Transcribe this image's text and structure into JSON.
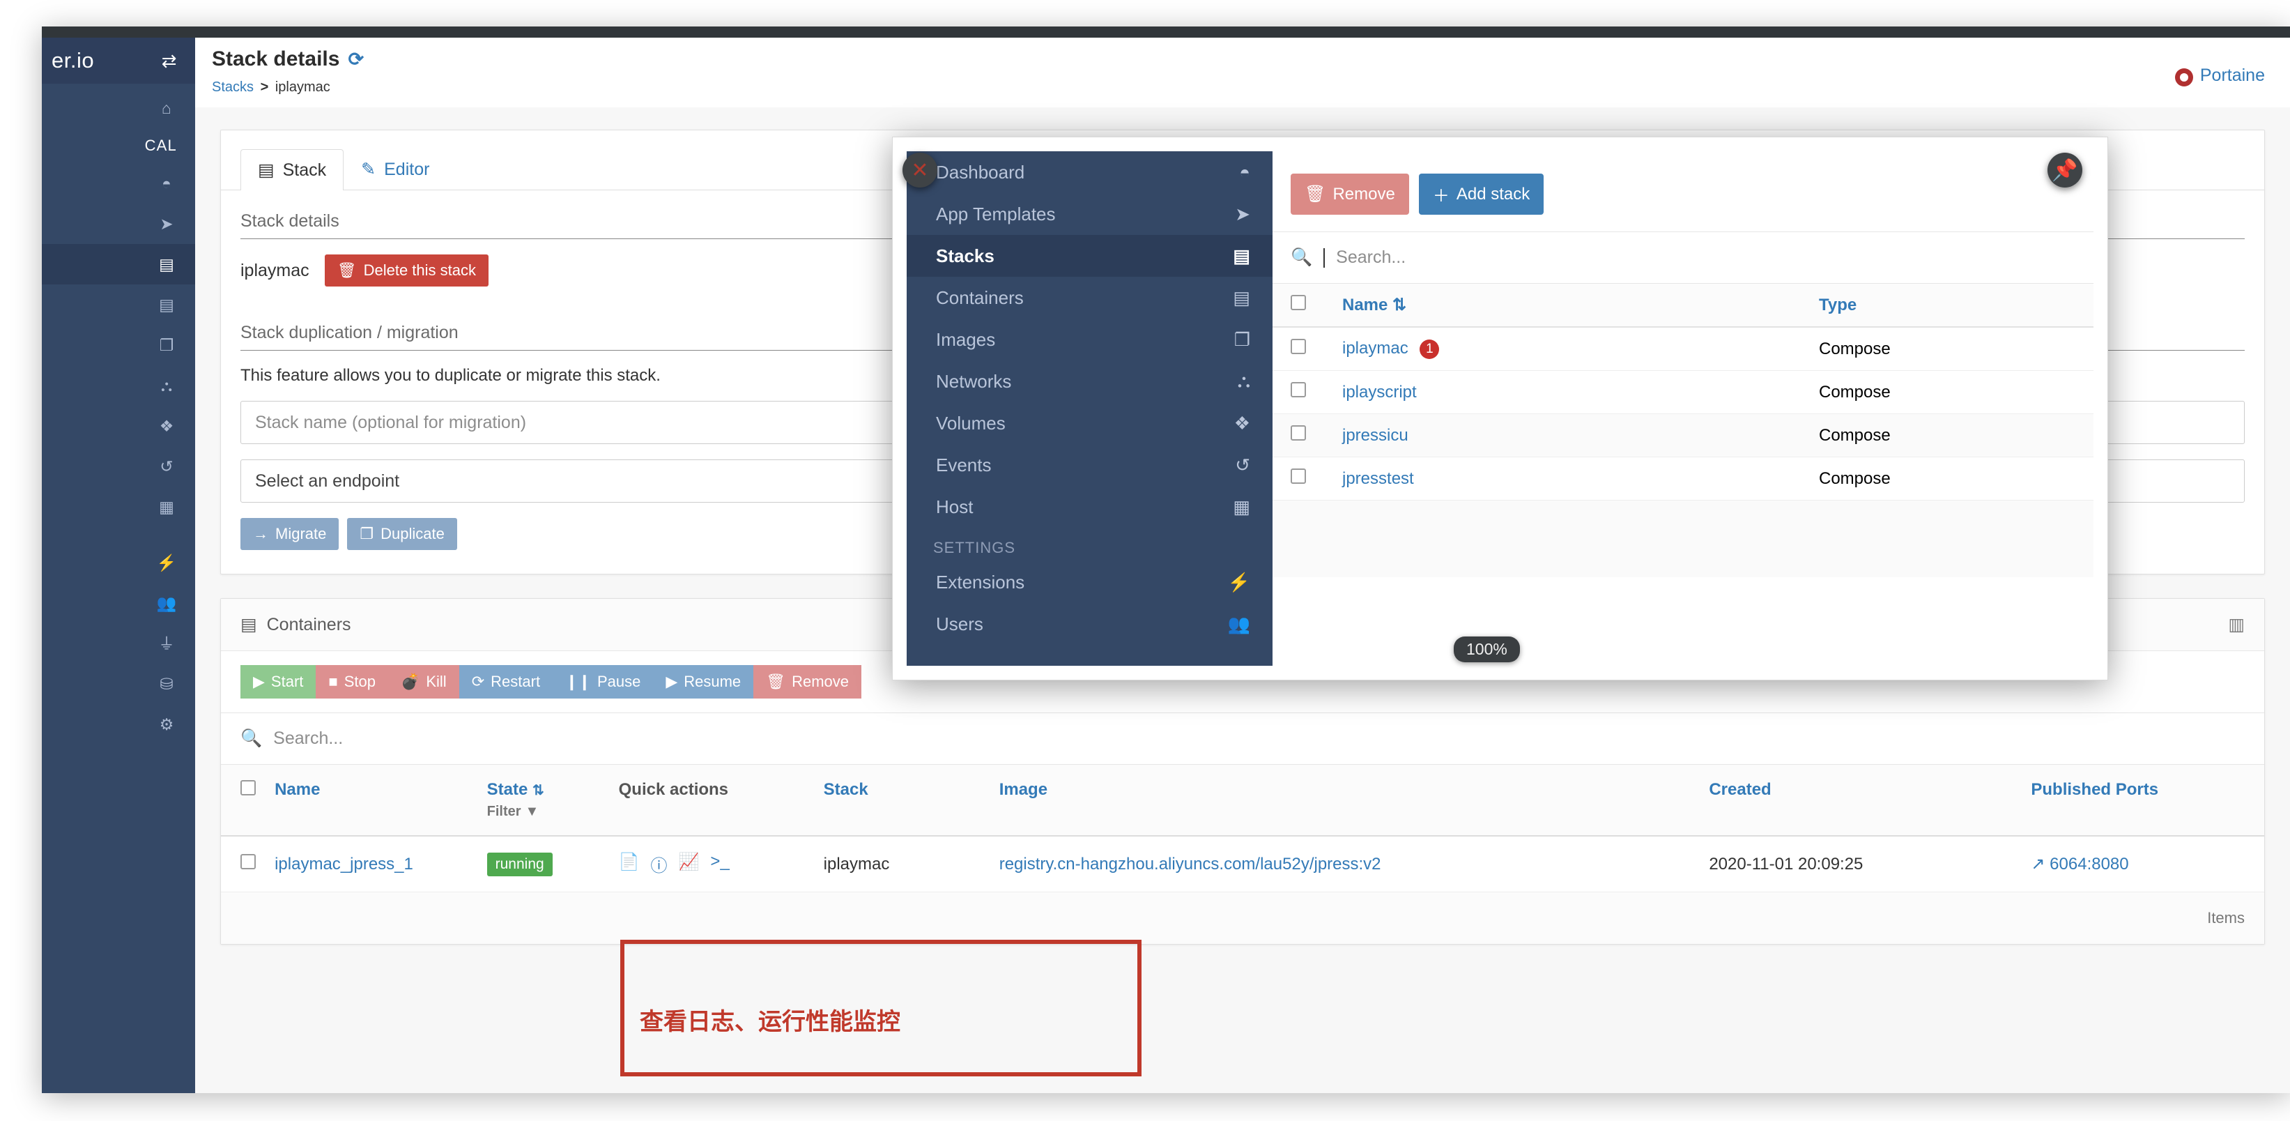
{
  "window": {
    "zoom_level": "100%"
  },
  "sidebar": {
    "brand": "er.io",
    "toggle_icon": "arrows-left-right-icon",
    "section_label": "CAL",
    "items": [
      {
        "icon": "home-icon"
      },
      {
        "icon": "dashboard-gauge-icon"
      },
      {
        "icon": "rocket-icon"
      },
      {
        "icon": "stacks-list-icon",
        "active": true
      },
      {
        "icon": "containers-server-icon"
      },
      {
        "icon": "images-copy-icon"
      },
      {
        "icon": "networks-sitemap-icon"
      },
      {
        "icon": "volumes-cubes-icon"
      },
      {
        "icon": "events-history-icon"
      },
      {
        "icon": "host-grid-icon"
      },
      {
        "icon": "extensions-bolt-icon"
      },
      {
        "icon": "users-icon"
      },
      {
        "icon": "endpoints-plug-icon"
      },
      {
        "icon": "registries-database-icon"
      },
      {
        "icon": "settings-gears-icon"
      }
    ]
  },
  "header": {
    "title": "Stack details",
    "refresh_icon": "refresh-icon",
    "breadcrumb": {
      "root": "Stacks",
      "separator": ">",
      "current": "iplaymac"
    },
    "support_label": "Portaine",
    "support_icon": "life-ring-icon"
  },
  "stack_panel": {
    "tabs": [
      {
        "label": "Stack",
        "icon": "list-icon",
        "active": true
      },
      {
        "label": "Editor",
        "icon": "pencil-icon",
        "active": false
      }
    ],
    "details_title": "Stack details",
    "stack_name": "iplaymac",
    "delete_button": "Delete this stack",
    "delete_icon": "trash-icon",
    "migration_title": "Stack duplication / migration",
    "migration_desc": "This feature allows you to duplicate or migrate this stack.",
    "name_placeholder": "Stack name (optional for migration)",
    "endpoint_placeholder": "Select an endpoint",
    "migrate_button": "Migrate",
    "migrate_icon": "arrow-right-icon",
    "duplicate_button": "Duplicate",
    "duplicate_icon": "copy-icon"
  },
  "containers_panel": {
    "title": "Containers",
    "title_icon": "server-icon",
    "columns_icon": "columns-icon",
    "actions": [
      {
        "label": "Start",
        "icon": "play-icon",
        "style": "green"
      },
      {
        "label": "Stop",
        "icon": "stop-icon",
        "style": "red"
      },
      {
        "label": "Kill",
        "icon": "bomb-icon",
        "style": "red"
      },
      {
        "label": "Restart",
        "icon": "restart-icon",
        "style": "blue"
      },
      {
        "label": "Pause",
        "icon": "pause-icon",
        "style": "blue"
      },
      {
        "label": "Resume",
        "icon": "play-icon",
        "style": "blue"
      },
      {
        "label": "Remove",
        "icon": "trash-icon",
        "style": "red"
      }
    ],
    "search_placeholder": "Search...",
    "search_icon": "search-icon",
    "columns": {
      "name": "Name",
      "state": "State",
      "state_sort_icon": "sort-az-icon",
      "filter": "Filter",
      "filter_icon": "funnel-icon",
      "quick_actions": "Quick actions",
      "stack": "Stack",
      "image": "Image",
      "created": "Created",
      "published_ports": "Published Ports"
    },
    "rows": [
      {
        "name": "iplaymac_jpress_1",
        "state": "running",
        "quick_actions": [
          "logs-file-icon",
          "info-icon",
          "stats-chart-icon",
          "console-terminal-icon"
        ],
        "stack": "iplaymac",
        "image": "registry.cn-hangzhou.aliyuncs.com/lau52y/jpress:v2",
        "created": "2020-11-01 20:09:25",
        "published_ports": "6064:8080",
        "port_icon": "external-link-icon"
      }
    ],
    "footer_label": "Items"
  },
  "overlay": {
    "close_icon": "close-x-icon",
    "pin_icon": "pin-icon",
    "nav": {
      "items": [
        {
          "label": "Dashboard",
          "icon": "dashboard-gauge-icon",
          "active": false
        },
        {
          "label": "App Templates",
          "icon": "rocket-icon",
          "active": false
        },
        {
          "label": "Stacks",
          "icon": "stacks-list-icon",
          "active": true
        },
        {
          "label": "Containers",
          "icon": "containers-server-icon",
          "active": false
        },
        {
          "label": "Images",
          "icon": "images-copy-icon",
          "active": false
        },
        {
          "label": "Networks",
          "icon": "networks-sitemap-icon",
          "active": false
        },
        {
          "label": "Volumes",
          "icon": "volumes-cubes-icon",
          "active": false
        },
        {
          "label": "Events",
          "icon": "events-history-icon",
          "active": false
        },
        {
          "label": "Host",
          "icon": "host-grid-icon",
          "active": false
        }
      ],
      "section_label": "SETTINGS",
      "settings_items": [
        {
          "label": "Extensions",
          "icon": "extensions-bolt-icon"
        },
        {
          "label": "Users",
          "icon": "users-icon"
        }
      ]
    },
    "toolbar": {
      "remove_label": "Remove",
      "remove_icon": "trash-icon",
      "add_label": "Add stack",
      "add_icon": "plus-icon"
    },
    "search_placeholder": "Search...",
    "search_icon": "search-icon",
    "table": {
      "col_name": "Name",
      "col_name_sort_icon": "sort-az-icon",
      "col_type": "Type",
      "rows": [
        {
          "name": "iplaymac",
          "badge": "1",
          "type": "Compose"
        },
        {
          "name": "iplayscript",
          "badge": "",
          "type": "Compose"
        },
        {
          "name": "jpressicu",
          "badge": "",
          "type": "Compose"
        },
        {
          "name": "jpresstest",
          "badge": "",
          "type": "Compose"
        }
      ]
    }
  },
  "annotation": {
    "text": "查看日志、运行性能监控",
    "color": "#c0392b"
  }
}
